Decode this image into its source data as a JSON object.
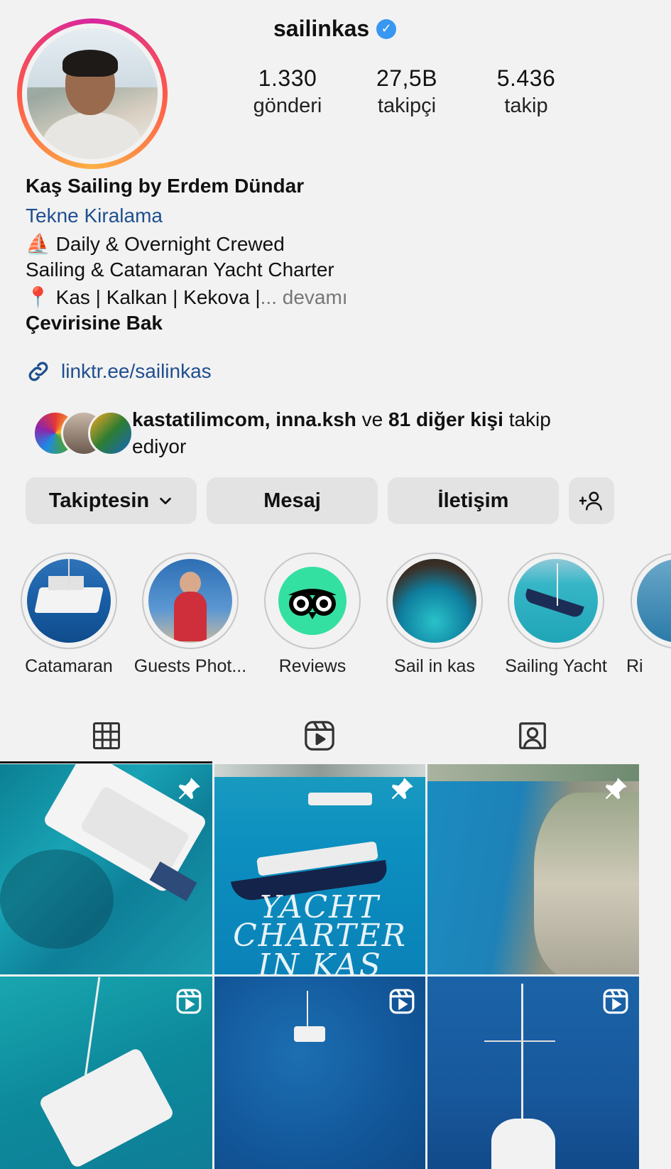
{
  "profile": {
    "username": "sailinkas",
    "stats": [
      {
        "value": "1.330",
        "label": "gönderi"
      },
      {
        "value": "27,5B",
        "label": "takipçi"
      },
      {
        "value": "5.436",
        "label": "takip"
      }
    ],
    "display_name": "Kaş Sailing by Erdem Dündar",
    "category": "Tekne Kiralama",
    "bio_line1": "Daily & Overnight Crewed",
    "bio_line2": "Sailing & Catamaran Yacht Charter",
    "bio_line3": "Kas | Kalkan | Kekova |",
    "bio_more": "... devamı",
    "translate": "Çevirisine Bak",
    "link": "linktr.ee/sailinkas",
    "followed_by_names": "kastatilimcom, inna.ksh",
    "followed_by_and": "ve",
    "followed_by_others": "81 diğer kişi",
    "followed_by_suffix": "takip ediyor"
  },
  "buttons": {
    "following": "Takiptesin",
    "message": "Mesaj",
    "contact": "İletişim"
  },
  "highlights": [
    {
      "label": "Catamaran"
    },
    {
      "label": "Guests Phot..."
    },
    {
      "label": "Reviews"
    },
    {
      "label": "Sail in kas"
    },
    {
      "label": "Sailing Yacht"
    },
    {
      "label": "Ri"
    }
  ],
  "grid": {
    "post2_text_line1": "YACHT",
    "post2_text_line2": "CHARTER",
    "post2_text_line3": "IN KAS"
  },
  "colors": {
    "link": "#1f4f8f",
    "verified": "#3897f0",
    "button_bg": "#e3e3e3",
    "tripadvisor": "#34e0a1"
  },
  "icons": [
    "verified-badge-icon",
    "sailboat-emoji-icon",
    "pin-emoji-icon",
    "link-icon",
    "chevron-down-icon",
    "add-person-icon",
    "grid-icon",
    "reels-icon",
    "tagged-icon",
    "pin-icon",
    "reel-badge-icon",
    "tripadvisor-owl-icon"
  ]
}
